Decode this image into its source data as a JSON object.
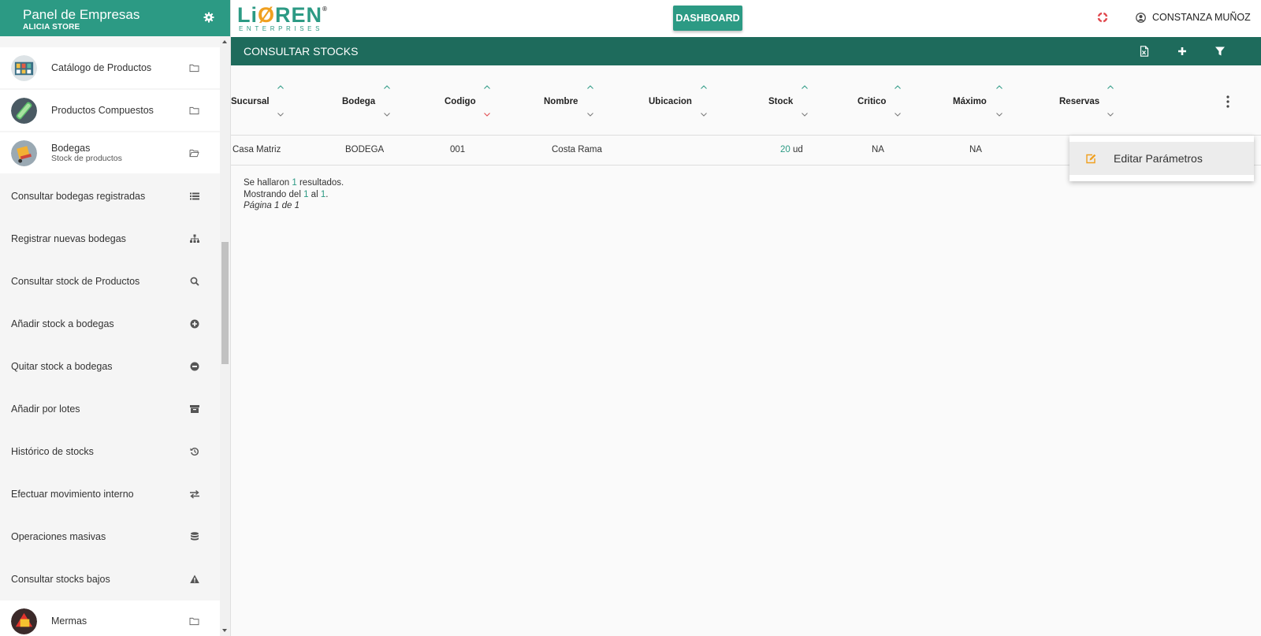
{
  "sidebar": {
    "header": {
      "title": "Panel de Empresas",
      "subtitle": "ALICIA STORE"
    },
    "sections": [
      {
        "label": "Catálogo de Productos",
        "icon": "folder-icon"
      },
      {
        "label": "Productos Compuestos",
        "icon": "folder-icon"
      },
      {
        "label": "Bodegas",
        "sublabel": "Stock de productos",
        "icon": "folder-open-icon"
      }
    ],
    "items": [
      {
        "label": "Consultar bodegas registradas",
        "icon": "list-icon"
      },
      {
        "label": "Registrar nuevas bodegas",
        "icon": "sitemap-icon"
      },
      {
        "label": "Consultar stock de Productos",
        "icon": "search-icon"
      },
      {
        "label": "Añadir stock a bodegas",
        "icon": "plus-circle-icon"
      },
      {
        "label": "Quitar stock a bodegas",
        "icon": "minus-circle-icon"
      },
      {
        "label": "Añadir por lotes",
        "icon": "archive-icon"
      },
      {
        "label": "Histórico de stocks",
        "icon": "history-icon"
      },
      {
        "label": "Efectuar movimiento interno",
        "icon": "exchange-icon"
      },
      {
        "label": "Operaciones masivas",
        "icon": "database-icon"
      },
      {
        "label": "Consultar stocks bajos",
        "icon": "warning-icon"
      }
    ],
    "bottom_section": {
      "label": "Mermas",
      "icon": "folder-icon"
    }
  },
  "topbar": {
    "logo_main": "LiØREN",
    "logo_sub": "ENTERPRISES",
    "logo_reg": "®",
    "dashboard_label": "DASHBOARD",
    "user_name": "CONSTANZA MUÑOZ"
  },
  "page": {
    "title": "CONSULTAR STOCKS"
  },
  "table": {
    "columns": [
      "Sucursal",
      "Bodega",
      "Codigo",
      "Nombre",
      "Ubicacion",
      "Stock",
      "Critico",
      "Máximo",
      "Reservas"
    ],
    "rows": [
      {
        "sucursal": "Casa Matriz",
        "bodega": "BODEGA",
        "codigo": "001",
        "nombre": "Costa Rama",
        "ubicacion": "",
        "stock_value": "20",
        "stock_unit": "ud",
        "critico": "NA",
        "maximo": "NA",
        "reservas": ""
      }
    ]
  },
  "summary": {
    "line1_pre": "Se hallaron ",
    "line1_count": "1",
    "line1_post": " resultados.",
    "line2_pre": "Mostrando del ",
    "line2_from": "1",
    "line2_mid": " al ",
    "line2_to": "1",
    "line2_post": ".",
    "line3": "Página 1 de 1"
  },
  "context_menu": {
    "edit_label": "Editar Parámetros"
  },
  "colors": {
    "accent": "#2c9a84",
    "title_bar": "#1e6b5c",
    "logo_orange": "#f0a020",
    "sort_active": "#e0474c"
  }
}
